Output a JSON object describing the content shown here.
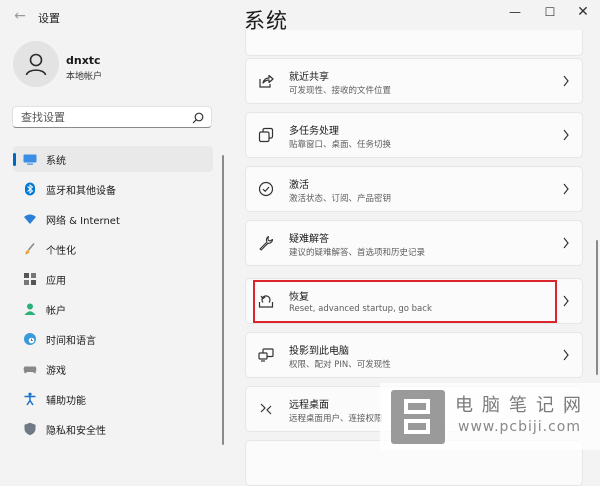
{
  "window": {
    "title": "设置",
    "back": "←",
    "minimize": "—",
    "maximize": "☐",
    "close": "✕"
  },
  "profile": {
    "name": "dnxtc",
    "account_type": "本地帐户"
  },
  "search": {
    "placeholder": "查找设置"
  },
  "sidebar": {
    "items": [
      {
        "label": "系统",
        "icon": "system-icon",
        "active": true
      },
      {
        "label": "蓝牙和其他设备",
        "icon": "bluetooth-icon"
      },
      {
        "label": "网络 & Internet",
        "icon": "wifi-icon"
      },
      {
        "label": "个性化",
        "icon": "brush-icon"
      },
      {
        "label": "应用",
        "icon": "apps-icon"
      },
      {
        "label": "帐户",
        "icon": "person-icon"
      },
      {
        "label": "时间和语言",
        "icon": "globe-clock-icon"
      },
      {
        "label": "游戏",
        "icon": "gamepad-icon"
      },
      {
        "label": "辅助功能",
        "icon": "accessibility-icon"
      },
      {
        "label": "隐私和安全性",
        "icon": "shield-icon"
      }
    ]
  },
  "main": {
    "title": "系统",
    "cards": [
      {
        "title": "就近共享",
        "subtitle": "可发现性、接收的文件位置",
        "icon": "share-icon"
      },
      {
        "title": "多任务处理",
        "subtitle": "贴靠窗口、桌面、任务切换",
        "icon": "multitask-icon"
      },
      {
        "title": "激活",
        "subtitle": "激活状态、订阅、产品密钥",
        "icon": "check-circle-icon"
      },
      {
        "title": "疑难解答",
        "subtitle": "建议的疑难解答、首选项和历史记录",
        "icon": "wrench-icon"
      },
      {
        "title": "恢复",
        "subtitle": "Reset, advanced startup, go back",
        "icon": "recovery-icon",
        "highlighted": true
      },
      {
        "title": "投影到此电脑",
        "subtitle": "权限、配对 PIN、可发现性",
        "icon": "project-icon"
      },
      {
        "title": "远程桌面",
        "subtitle": "远程桌面用户、连接权限",
        "icon": "remote-desktop-icon"
      }
    ]
  },
  "watermark": {
    "text_cn": "电脑笔记网",
    "url": "www.pcbiji.com"
  },
  "colors": {
    "accent": "#0067c0",
    "highlight": "#d9252b",
    "background": "#f3f3f3",
    "card": "#fbfbfb"
  }
}
